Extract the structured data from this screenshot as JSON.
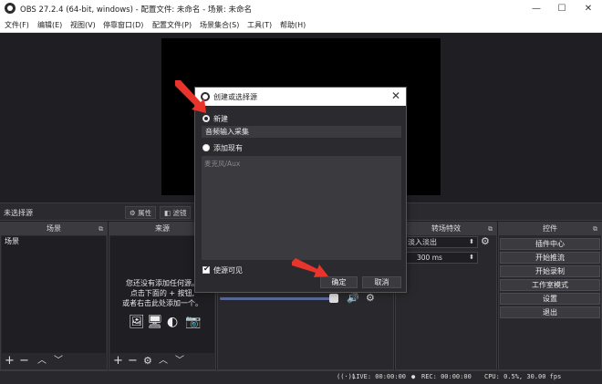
{
  "window": {
    "title": "OBS 27.2.4 (64-bit, windows) - 配置文件: 未命名 - 场景: 未命名",
    "minimize": "—",
    "maximize": "☐",
    "close": "✕"
  },
  "menu": [
    "文件(F)",
    "编辑(E)",
    "视图(V)",
    "停靠窗口(D)",
    "配置文件(P)",
    "场景集合(S)",
    "工具(T)",
    "帮助(H)"
  ],
  "source_strip": {
    "no_selection": "未选择源",
    "properties": "属性",
    "filters": "滤镜"
  },
  "scenes": {
    "header": "场景",
    "items": [
      "场景"
    ]
  },
  "sources": {
    "header": "来源",
    "empty_lines": [
      "您还没有添加任何源。",
      "点击下面的 + 按钮,",
      "或者右击此处添加一个。"
    ]
  },
  "transitions": {
    "header": "转场特效",
    "selected": "淡入淡出",
    "duration": "300 ms"
  },
  "controls": {
    "header": "控件",
    "buttons": [
      "插件中心",
      "开始推流",
      "开始录制",
      "工作室模式",
      "设置",
      "退出"
    ]
  },
  "status": {
    "live": "LIVE: 00:00:00",
    "rec": "REC: 00:00:00",
    "cpu": "CPU: 0.5%, 30.00 fps"
  },
  "dialog": {
    "title": "创建或选择源",
    "create_new": "新建",
    "new_name": "音频输入采集",
    "add_existing": "添加现有",
    "existing_item": "麦克风/Aux",
    "make_visible": "使源可见",
    "ok": "确定",
    "cancel": "取消"
  },
  "colors": {
    "accent_arrow": "#e8342a",
    "panel_bg": "#29292d",
    "dark_bg": "#1f1f23"
  }
}
